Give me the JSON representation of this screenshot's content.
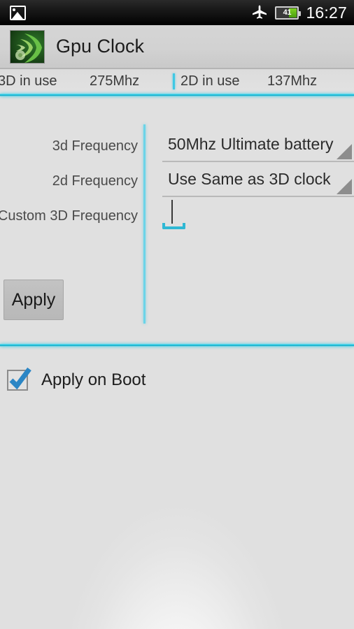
{
  "statusbar": {
    "gallery_icon": "gallery-icon",
    "airplane_icon": "airplane-mode-icon",
    "battery_icon": "battery-icon",
    "battery_percent": "41",
    "time": "16:27"
  },
  "titlebar": {
    "app_icon": "gpu-clock-app-icon",
    "title": "Gpu Clock"
  },
  "status_row": {
    "label_3d": "3D in use",
    "value_3d": "275Mhz",
    "label_2d": "2D in use",
    "value_2d": "137Mhz"
  },
  "form": {
    "rows": [
      {
        "label": "3d Frequency",
        "value": "50Mhz Ultimate battery"
      },
      {
        "label": "2d Frequency",
        "value": "Use Same as 3D clock"
      },
      {
        "label": "Custom 3D Frequency",
        "value": ""
      }
    ],
    "apply_label": "Apply"
  },
  "boot": {
    "label": "Apply on Boot",
    "checked": "true"
  },
  "colors": {
    "accent_cyan": "#18bcd8",
    "divider_cyan": "#6bd4e8",
    "battery_green": "#7ed321",
    "titlebar_gray": "#d2d2d2",
    "body_gray": "#e4e4e4"
  }
}
